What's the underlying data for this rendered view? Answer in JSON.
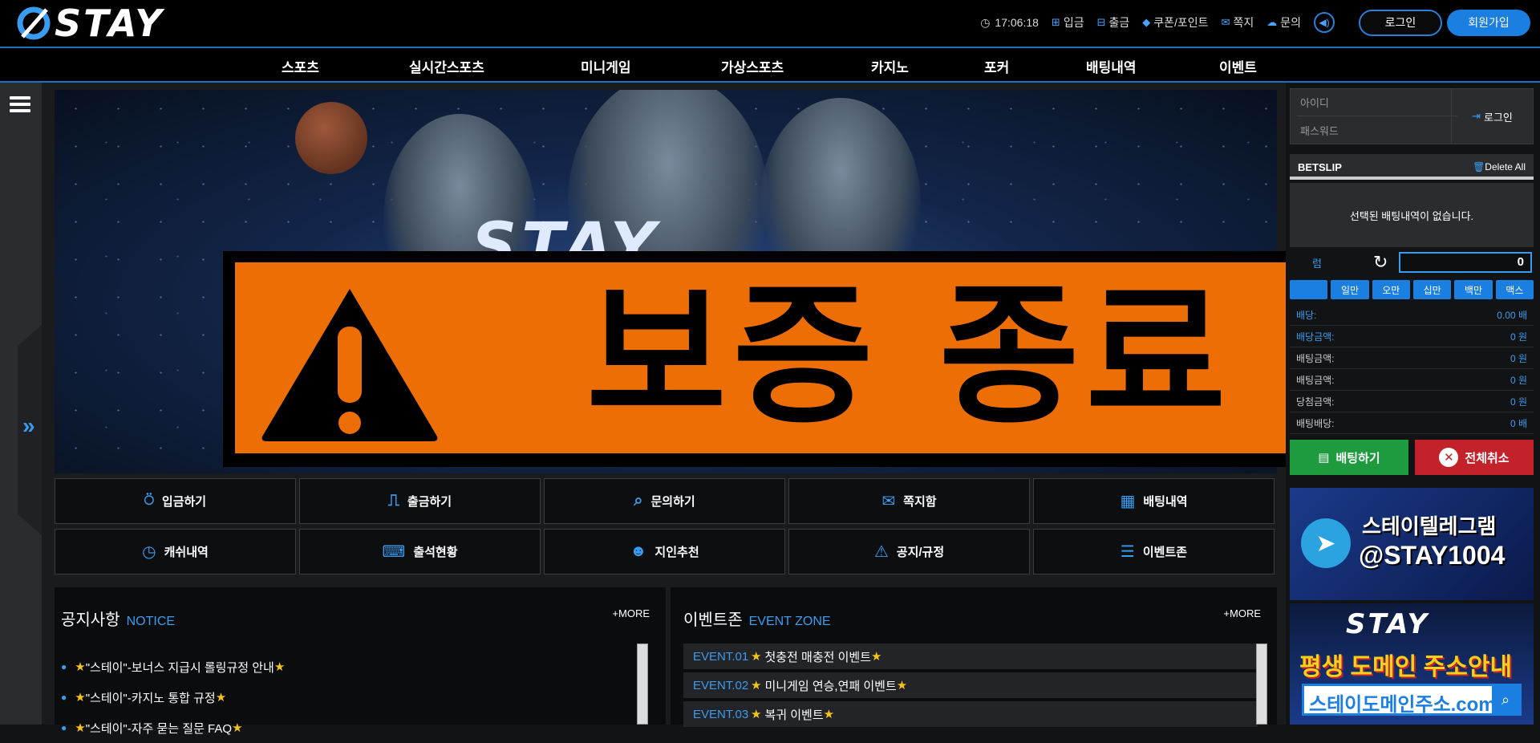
{
  "brand": {
    "logo_text": "STAY"
  },
  "header": {
    "time": "17:06:18",
    "links": [
      {
        "label": "입금",
        "icon": "plus-square-icon"
      },
      {
        "label": "출금",
        "icon": "minus-square-icon"
      },
      {
        "label": "쿠폰/포인트",
        "icon": "tag-icon"
      },
      {
        "label": "쪽지",
        "icon": "envelope-icon"
      },
      {
        "label": "문의",
        "icon": "chat-icon"
      }
    ],
    "login_label": "로그인",
    "join_label": "회원가입"
  },
  "nav": [
    "스포츠",
    "실시간스포츠",
    "미니게임",
    "가상스포츠",
    "카지노",
    "포커",
    "배팅내역",
    "이벤트"
  ],
  "banner": {
    "logo_text": "STAY",
    "warning_text": "보증 종료"
  },
  "quick_menu": [
    {
      "label": "입금하기",
      "icon": "deposit-icon"
    },
    {
      "label": "출금하기",
      "icon": "withdraw-icon"
    },
    {
      "label": "문의하기",
      "icon": "inquiry-icon"
    },
    {
      "label": "쪽지함",
      "icon": "message-icon"
    },
    {
      "label": "배팅내역",
      "icon": "calendar-icon"
    },
    {
      "label": "캐쉬내역",
      "icon": "clock-icon"
    },
    {
      "label": "출석현황",
      "icon": "keyboard-icon"
    },
    {
      "label": "지인추천",
      "icon": "users-icon"
    },
    {
      "label": "공지/규정",
      "icon": "warning-icon"
    },
    {
      "label": "이벤트존",
      "icon": "list-icon"
    }
  ],
  "notice": {
    "title": "공지사항",
    "title_en": "NOTICE",
    "more": "+MORE",
    "items": [
      "\"스테이\"-보너스 지급시 롤링규정 안내",
      "\"스테이\"-카지노 통합 규정",
      "\"스테이\"-자주 묻는 질문 FAQ"
    ]
  },
  "events": {
    "title": "이벤트존",
    "title_en": "EVENT ZONE",
    "more": "+MORE",
    "items": [
      {
        "no": "EVENT.01",
        "title": "첫충전 매충전 이벤트"
      },
      {
        "no": "EVENT.02",
        "title": "미니게임 연승,연패 이벤트"
      },
      {
        "no": "EVENT.03",
        "title": "복귀 이벤트 "
      }
    ]
  },
  "login_box": {
    "id_placeholder": "아이디",
    "pw_placeholder": "패스워드",
    "button": "로그인"
  },
  "betslip": {
    "title": "BETSLIP",
    "delete_all": "Delete All",
    "empty_text": "선택된 배팅내역이 없습니다.",
    "amount_label": "럼",
    "amount_value": "0",
    "chips": [
      "",
      "일만",
      "오만",
      "십만",
      "백만",
      "맥스"
    ],
    "stats": [
      {
        "k": "배당:",
        "v": "0.00 배"
      },
      {
        "k": "배당금액:",
        "v": "0 원"
      },
      {
        "k": "배팅금액:",
        "v": "0 원"
      },
      {
        "k": "배팅금액:",
        "v": "0 원"
      },
      {
        "k": "당첨금액:",
        "v": "0 원"
      },
      {
        "k": "배팅배당:",
        "v": "0 배"
      }
    ],
    "bet_button": "배팅하기",
    "cancel_button": "전체취소"
  },
  "promo": {
    "telegram_line1": "스테이텔레그램",
    "telegram_line2": "@STAY1004",
    "domain_logo": "STAY",
    "domain_line1": "평생 도메인 주소안내",
    "domain_url": "스테이도메인주소.com"
  }
}
